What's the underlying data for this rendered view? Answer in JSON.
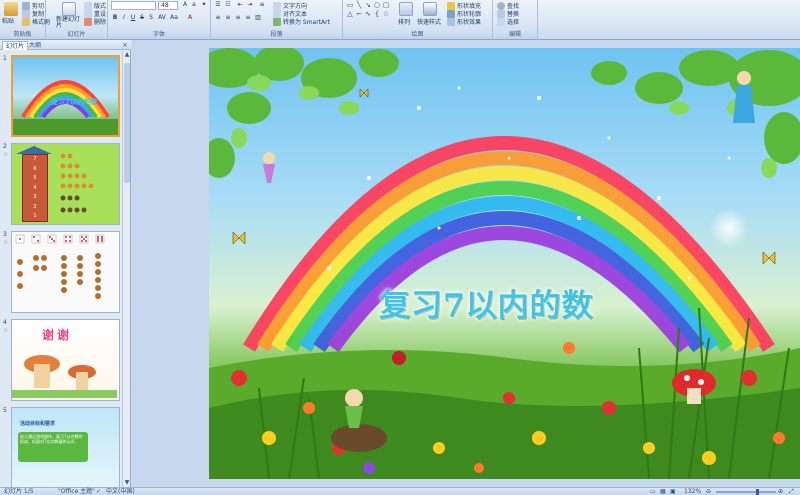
{
  "ribbon": {
    "clipboard": {
      "group_label": "剪贴板",
      "paste": "粘贴",
      "cut": "剪切",
      "copy": "复制",
      "format_painter": "格式刷"
    },
    "slides": {
      "group_label": "幻灯片",
      "new_slide": "新建幻灯片",
      "layout": "版式",
      "reset": "重设",
      "delete": "删除"
    },
    "font": {
      "group_label": "字体",
      "font_name": "",
      "font_size": "48"
    },
    "paragraph": {
      "group_label": "段落",
      "text_direction": "文字方向",
      "align_text": "对齐文本",
      "smartart": "转换为 SmartArt"
    },
    "drawing": {
      "group_label": "绘图",
      "arrange": "排列",
      "quick_styles": "快速样式",
      "shape_fill": "形状填充",
      "shape_outline": "形状轮廓",
      "shape_effects": "形状效果"
    },
    "editing": {
      "group_label": "编辑",
      "find": "查找",
      "replace": "替换",
      "select": "选择"
    }
  },
  "panel": {
    "tabs": [
      "幻灯片",
      "大纲"
    ],
    "close": "×",
    "slides": [
      {
        "number": "1",
        "title": "复习7以内的数"
      },
      {
        "number": "2",
        "ladder_numbers": [
          "7",
          "6",
          "5",
          "4",
          "3",
          "2",
          "1"
        ]
      },
      {
        "number": "3"
      },
      {
        "number": "4",
        "title": "谢谢"
      },
      {
        "number": "5",
        "heading": "活动目标和要求",
        "body": "幼儿通过游戏操作，复习7以内数的形成，巩固对7以内数量的认识。"
      }
    ]
  },
  "slide": {
    "title": "复习7以内的数"
  },
  "status": {
    "slide_counter": "幻灯片 1/5",
    "theme": "\"Office 主题\"",
    "language": "中文(中国)",
    "zoom": "132%"
  },
  "colors": {
    "accent": "#f0a030",
    "title": "#45c2e0",
    "ribbon": "#dbe6f4"
  }
}
